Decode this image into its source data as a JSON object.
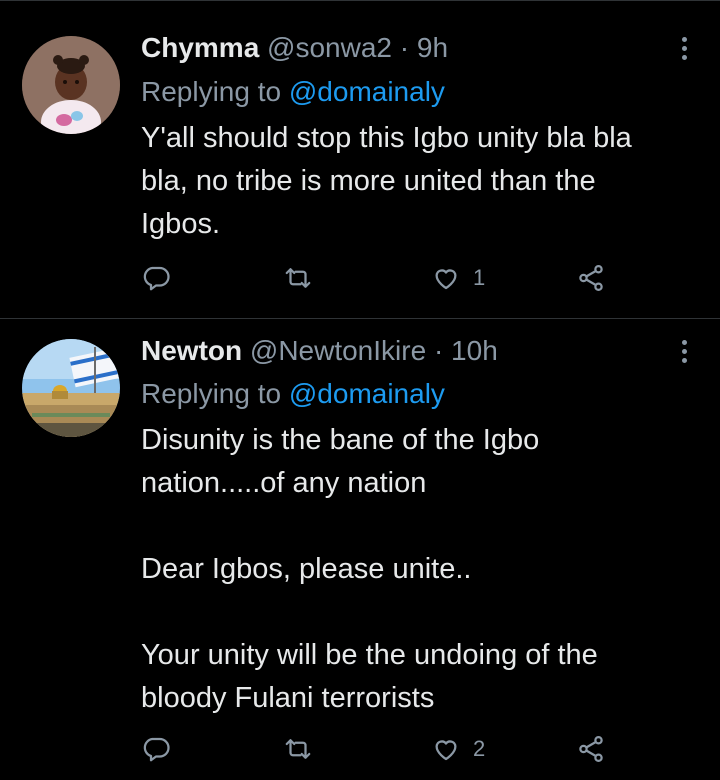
{
  "tweets": [
    {
      "author_name": "Chymma",
      "handle": "@sonwa2",
      "separator": "·",
      "time": "9h",
      "replying_prefix": "Replying to",
      "replying_to": "@domainaly",
      "text_lines": [
        "Y'all should stop this Igbo unity bla bla",
        "bla, no tribe is more united than the",
        "Igbos."
      ],
      "avatar_icon": "child-photo-avatar",
      "like_count": "1"
    },
    {
      "author_name": "Newton",
      "handle": "@NewtonIkire",
      "separator": "·",
      "time": "10h",
      "replying_prefix": "Replying to",
      "replying_to": "@domainaly",
      "text_lines": [
        "Disunity is the bane of the Igbo",
        "nation.....of any nation",
        "",
        "Dear Igbos, please unite..",
        "",
        "Your unity will be the undoing of the",
        "bloody Fulani terrorists"
      ],
      "avatar_icon": "jerusalem-flag-avatar",
      "like_count": "2"
    }
  ],
  "colors": {
    "background": "#000000",
    "text": "#e7e9ea",
    "muted": "#8b98a5",
    "link": "#1d9bf0",
    "divider": "#2f3336"
  },
  "icons": [
    "reply-icon",
    "retweet-icon",
    "like-icon",
    "share-icon",
    "more-options-icon"
  ]
}
